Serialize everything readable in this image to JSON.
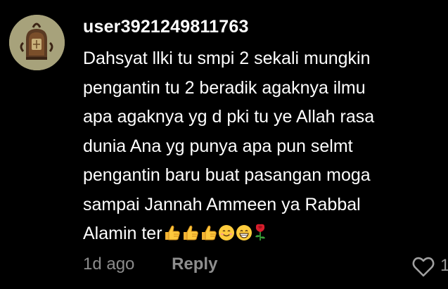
{
  "comment": {
    "username": "user3921249811763",
    "text_lines": [
      "Dahsyat llki tu smpi 2 sekali mungkin",
      "pengantin tu 2 beradik agaknya ilmu",
      "apa agaknya yg d pki tu ye Allah rasa",
      "dunia Ana yg punya apa pun selmt",
      "pengantin baru buat pasangan moga",
      "sampai Jannah Ammeen ya Rabbal",
      "Alamin ter"
    ],
    "emojis": [
      "thumbs-up",
      "thumbs-up",
      "thumbs-up",
      "smiling-face",
      "grinning-face",
      "rose"
    ],
    "date": "1d ago",
    "reply_label": "Reply",
    "like_count": "1"
  },
  "colors": {
    "background": "#000000",
    "text": "#ffffff",
    "secondary_text": "#8b8b8b"
  }
}
